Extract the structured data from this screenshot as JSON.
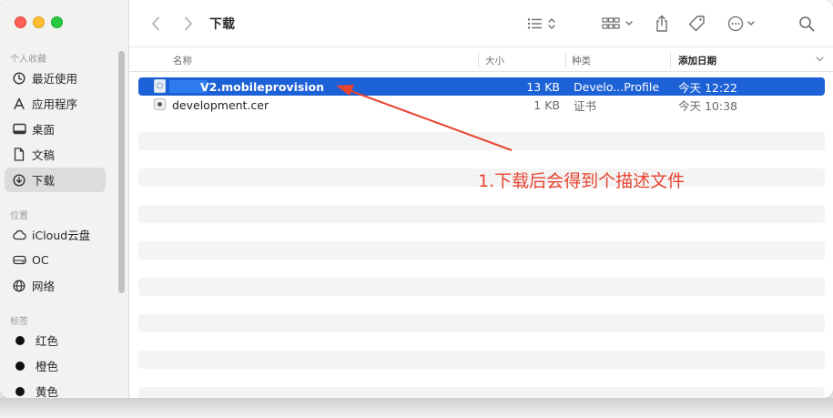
{
  "sidebar": {
    "favorites_title": "个人收藏",
    "favorites": [
      {
        "label": "最近使用",
        "icon": "clock-icon"
      },
      {
        "label": "应用程序",
        "icon": "apps-icon"
      },
      {
        "label": "桌面",
        "icon": "desktop-icon"
      },
      {
        "label": "文稿",
        "icon": "document-icon"
      },
      {
        "label": "下载",
        "icon": "download-icon",
        "selected": true
      }
    ],
    "locations_title": "位置",
    "locations": [
      {
        "label": "iCloud云盘",
        "icon": "cloud-icon"
      },
      {
        "label": "OC",
        "icon": "drive-icon"
      },
      {
        "label": "网络",
        "icon": "globe-icon"
      }
    ],
    "tags_title": "标签",
    "tags": [
      {
        "label": "红色"
      },
      {
        "label": "橙色"
      },
      {
        "label": "黄色"
      }
    ]
  },
  "toolbar": {
    "title": "下载"
  },
  "columns": {
    "name": "名称",
    "size": "大小",
    "kind": "种类",
    "date": "添加日期"
  },
  "files": [
    {
      "name": "V2.mobileprovision",
      "size": "13 KB",
      "kind": "Develo...Profile",
      "date": "今天 12:22",
      "selected": true
    },
    {
      "name": "development.cer",
      "size": "1 KB",
      "kind": "证书",
      "date": "今天 10:38",
      "selected": false
    }
  ],
  "annotation": {
    "text": "1.下载后会得到个描述文件",
    "color": "#e8432f"
  },
  "colors": {
    "selection": "#1d61d6",
    "close": "#fe5f57",
    "minimize": "#febc2e",
    "zoom": "#28c840"
  }
}
